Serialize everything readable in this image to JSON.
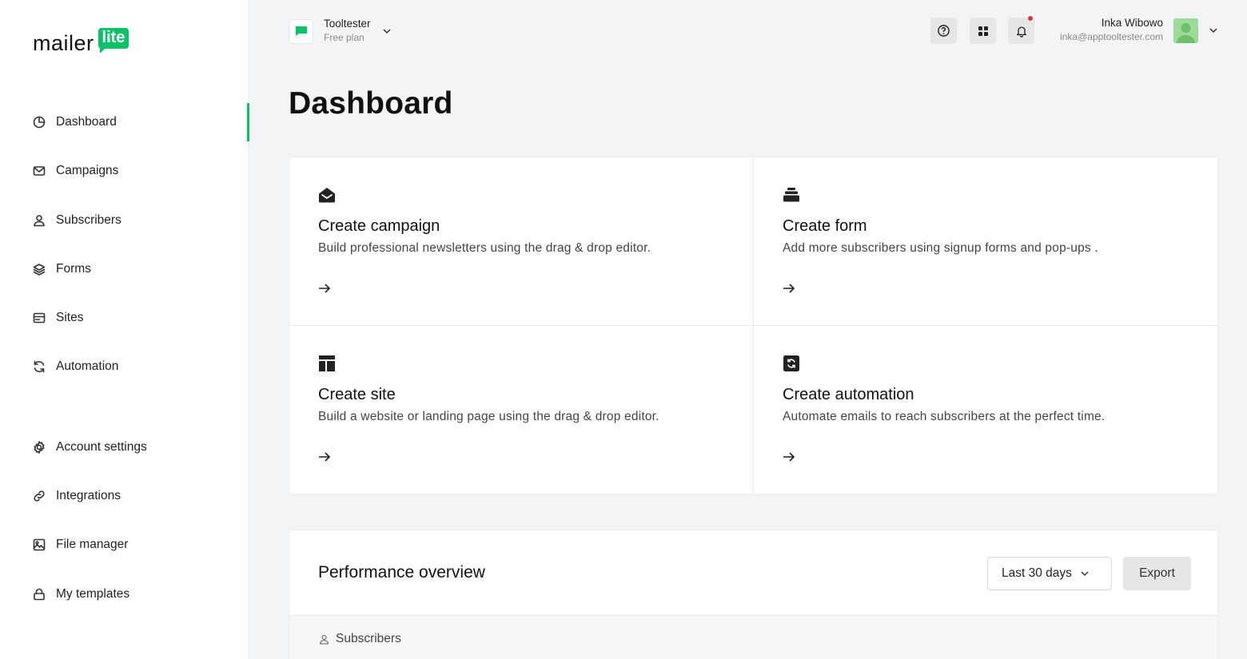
{
  "brand": {
    "word": "mailer",
    "badge": "lite",
    "accent": "#09c269"
  },
  "sidebar": {
    "items": [
      {
        "label": "Dashboard",
        "icon": "dashboard-icon",
        "active": true
      },
      {
        "label": "Campaigns",
        "icon": "mail-icon"
      },
      {
        "label": "Subscribers",
        "icon": "user-icon"
      },
      {
        "label": "Forms",
        "icon": "layers-icon"
      },
      {
        "label": "Sites",
        "icon": "browser-icon"
      },
      {
        "label": "Automation",
        "icon": "refresh-icon"
      }
    ],
    "settings_items": [
      {
        "label": "Account settings",
        "icon": "gear-icon"
      },
      {
        "label": "Integrations",
        "icon": "link-icon"
      },
      {
        "label": "File manager",
        "icon": "image-icon"
      },
      {
        "label": "My templates",
        "icon": "lock-icon"
      }
    ]
  },
  "topbar": {
    "account_name": "Tooltester",
    "account_plan": "Free plan",
    "user_name": "Inka Wibowo",
    "user_email": "inka@apptooltester.com",
    "has_notification": true
  },
  "page": {
    "title": "Dashboard"
  },
  "cards": [
    {
      "title": "Create campaign",
      "desc": "Build professional newsletters using the drag & drop editor.",
      "icon": "open-envelope-icon"
    },
    {
      "title": "Create form",
      "desc": "Add more subscribers using signup forms and pop-ups .",
      "icon": "form-stack-icon"
    },
    {
      "title": "Create site",
      "desc": "Build a website or landing page using the drag & drop editor.",
      "icon": "site-layout-icon"
    },
    {
      "title": "Create automation",
      "desc": "Automate emails to reach subscribers at the perfect time.",
      "icon": "automation-icon"
    }
  ],
  "performance": {
    "title": "Performance overview",
    "range": "Last 30 days",
    "export_label": "Export",
    "section_label": "Subscribers"
  }
}
